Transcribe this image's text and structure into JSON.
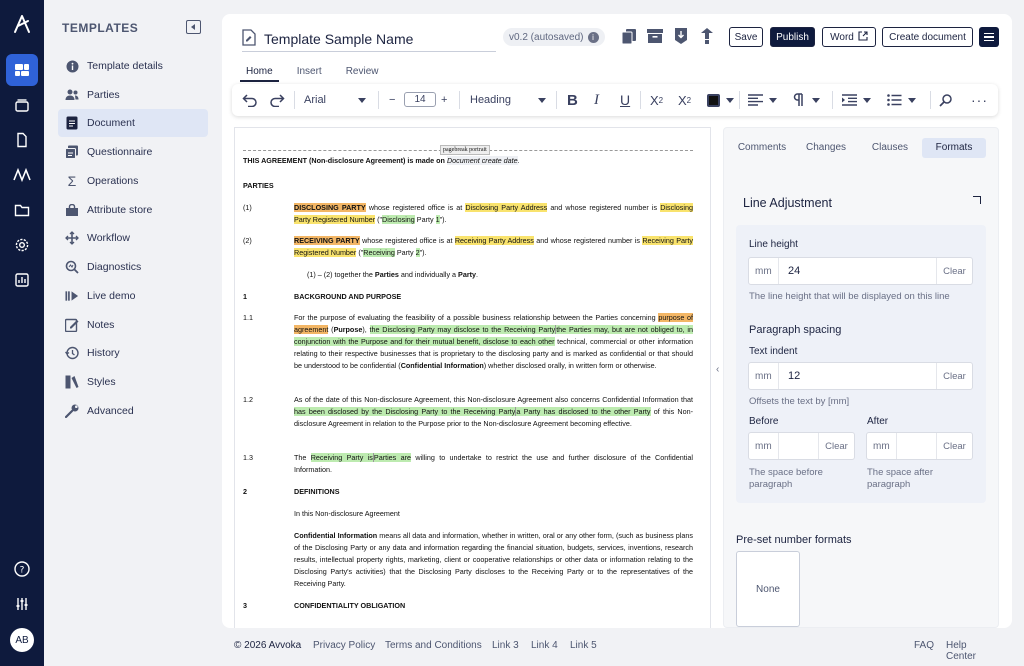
{
  "sidebar": {
    "title": "TEMPLATES",
    "items": [
      {
        "label": "Template details",
        "icon": "info-icon"
      },
      {
        "label": "Parties",
        "icon": "people-icon"
      },
      {
        "label": "Document",
        "icon": "document-icon"
      },
      {
        "label": "Questionnaire",
        "icon": "questionnaire-icon"
      },
      {
        "label": "Operations",
        "icon": "sigma-icon"
      },
      {
        "label": "Attribute store",
        "icon": "store-icon"
      },
      {
        "label": "Workflow",
        "icon": "workflow-icon"
      },
      {
        "label": "Diagnostics",
        "icon": "diagnostics-icon"
      },
      {
        "label": "Live demo",
        "icon": "play-icon"
      },
      {
        "label": "Notes",
        "icon": "notes-icon"
      },
      {
        "label": "History",
        "icon": "history-icon"
      },
      {
        "label": "Styles",
        "icon": "styles-icon"
      },
      {
        "label": "Advanced",
        "icon": "wrench-icon"
      }
    ]
  },
  "rail": {
    "avatar": "AB"
  },
  "header": {
    "doc_title": "Template Sample Name",
    "version": "v0.2 (autosaved)",
    "save": "Save",
    "publish": "Publish",
    "word": "Word",
    "create": "Create document"
  },
  "tabs": [
    "Home",
    "Insert",
    "Review"
  ],
  "toolbar": {
    "font": "Arial",
    "size": "14",
    "style": "Heading"
  },
  "document": {
    "pagebreak": "pagebreak portrait",
    "intro_a": "THIS AGREEMENT (",
    "intro_b": "Non-disclosure Agreement",
    "intro_c": ") is made on ",
    "intro_d": "Document create date",
    "intro_e": ".",
    "parties_heading": "PARTIES",
    "p1_num": "(1)",
    "p1_a": "DISCLOSING PARTY",
    "p1_b": " whose registered office is at ",
    "p1_c": "Disclosing Party Address",
    "p1_d": " and whose registered number is ",
    "p1_e": "Disclosing Party Registered Number",
    "p1_f": " (\"",
    "p1_g": "Disclosing",
    "p1_h": " Party ",
    "p1_i": "1",
    "p1_j": "\").",
    "p2_num": "(2)",
    "p2_a": "RECEIVING PARTY",
    "p2_b": " whose registered office is at ",
    "p2_c": "Receiving Party Address",
    "p2_d": " and whose registered number is ",
    "p2_e": "Receiving Party Registered Number",
    "p2_f": " (\"",
    "p2_g": "Receiving",
    "p2_h": " Party ",
    "p2_i": "2",
    "p2_j": "\").",
    "together_a": "(1) – (2) together the ",
    "together_b": "Parties",
    "together_c": " and individually a ",
    "together_d": "Party",
    "together_e": ".",
    "s1_num": "1",
    "s1_title": "BACKGROUND AND PURPOSE",
    "s11_num": "1.1",
    "s11_a": "For the purpose of evaluating the feasibility of a possible business relationship between the Parties concerning ",
    "s11_b": "purpose of agreement",
    "s11_c": " (",
    "s11_d": "Purpose",
    "s11_e": "), ",
    "s11_f": "the Disclosing Party may disclose to the Receiving Party",
    "s11_g": "the Parties may, but are not obliged to, in conjunction with the Purpose and for their mutual benefit, disclose to each other",
    "s11_h": " technical, commercial or other information relating to their respective businesses that is proprietary to the disclosing party and is marked as confidential or that should be understood to be confidential (",
    "s11_i": "Confidential Information",
    "s11_j": ") whether disclosed orally, in written form or otherwise.",
    "s12_num": "1.2",
    "s12_a": "As of the date of this Non-disclosure Agreement, this Non-disclosure Agreement also concerns Confidential Information that ",
    "s12_b": "has been disclosed by the Disclosing Party to the Receiving Party",
    "s12_c": "a Party has disclosed to the other Party",
    "s12_d": " of this Non-disclosure Agreement in relation to the Purpose prior to the Non-disclosure Agreement becoming effective.",
    "s13_num": "1.3",
    "s13_a": "The ",
    "s13_b": "Receiving Party is",
    "s13_c": "Parties are",
    "s13_d": " willing to undertake to restrict the use and further disclosure of the Confidential Information.",
    "s2_num": "2",
    "s2_title": "DEFINITIONS",
    "s2_intro": "In this Non-disclosure Agreement",
    "s2_def_a": "Confidential Information",
    "s2_def_b": " means all data and information, whether in written, oral or any other form, (such as business plans of the Disclosing Party or any data and information regarding the financial situation, budgets, services, inventions, research results, intellectual property rights, marketing, client or cooperative relationships or other data or information relating to the Disclosing Party's activities) that the Disclosing Party discloses to the Receiving Party or to the representatives of the Receiving Party.",
    "s3_num": "3",
    "s3_title": "CONFIDENTIALITY OBLIGATION"
  },
  "panel": {
    "tabs": [
      "Comments",
      "Changes",
      "Clauses",
      "Formats"
    ],
    "title": "Line Adjustment",
    "line_height_label": "Line height",
    "line_height_unit": "mm",
    "line_height_value": "24",
    "clear": "Clear",
    "line_height_help": "The line height that will be displayed on this line",
    "para_spacing": "Paragraph spacing",
    "text_indent_label": "Text indent",
    "text_indent_unit": "mm",
    "text_indent_value": "12",
    "text_indent_help": "Offsets the text by [mm]",
    "before_label": "Before",
    "after_label": "After",
    "before_unit": "mm",
    "after_unit": "mm",
    "before_help": "The space before paragraph",
    "after_help": "The space after paragraph",
    "preset_title": "Pre-set number formats",
    "preset_none": "None"
  },
  "footer": {
    "copyright": "© 2026 Avvoka",
    "links": [
      "Privacy Policy",
      "Terms and Conditions",
      "Link 3",
      "Link 4",
      "Link 5"
    ],
    "faq": "FAQ",
    "help": "Help Center"
  }
}
